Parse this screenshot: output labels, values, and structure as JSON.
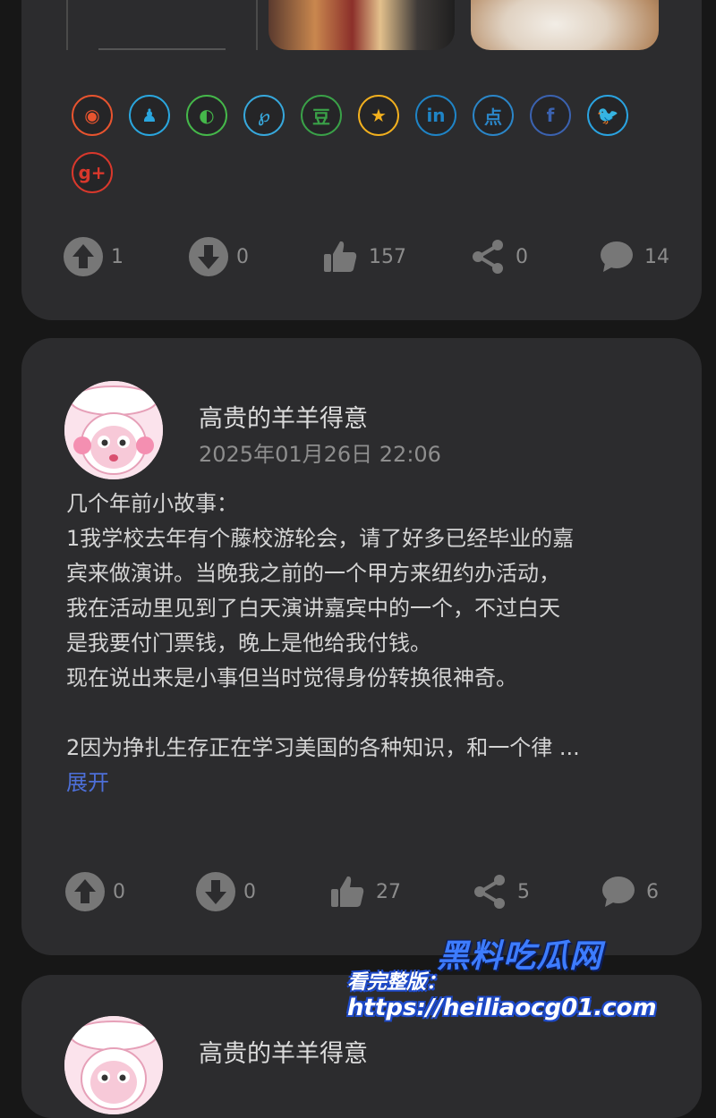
{
  "post1": {
    "share_icons": [
      {
        "name": "weibo-icon",
        "color": "#e8542f",
        "glyph": "◉"
      },
      {
        "name": "qq-icon",
        "color": "#2aa6de",
        "glyph": "♟"
      },
      {
        "name": "wechat-icon",
        "color": "#45b84a",
        "glyph": "◐"
      },
      {
        "name": "pinterest-icon",
        "color": "#37a8dc",
        "glyph": "℘"
      },
      {
        "name": "douban-icon",
        "color": "#3aa148",
        "glyph": "豆"
      },
      {
        "name": "qzone-icon",
        "color": "#f2b01e",
        "glyph": "★"
      },
      {
        "name": "linkedin-icon",
        "color": "#1f84c6",
        "glyph": "in"
      },
      {
        "name": "dianping-icon",
        "color": "#2b86c8",
        "glyph": "点"
      },
      {
        "name": "facebook-icon",
        "color": "#3b62b0",
        "glyph": "f"
      },
      {
        "name": "twitter-icon",
        "color": "#2aa3e0",
        "glyph": "🐦"
      },
      {
        "name": "googleplus-icon",
        "color": "#d9382c",
        "glyph": "g+"
      }
    ],
    "stats": {
      "upvotes": "1",
      "downvotes": "0",
      "likes": "157",
      "shares": "0",
      "comments": "14"
    }
  },
  "post2": {
    "author": "高贵的羊羊得意",
    "date": "2025年01月26日 22:06",
    "body": "几个年前小故事：\n1我学校去年有个藤校游轮会，请了好多已经毕业的嘉\n宾来做演讲。当晚我之前的一个甲方来纽约办活动，\n我在活动里见到了白天演讲嘉宾中的一个，不过白天\n是我要付门票钱，晚上是他给我付钱。\n现在说出来是小事但当时觉得身份转换很神奇。\n\n2因为挣扎生存正在学习美国的各种知识，和一个律 ...",
    "expand": "展开",
    "stats": {
      "upvotes": "0",
      "downvotes": "0",
      "likes": "27",
      "shares": "5",
      "comments": "6"
    }
  },
  "post3": {
    "author": "高贵的羊羊得意"
  },
  "watermark": {
    "title": "黑料吃瓜网",
    "label": "看完整版：",
    "url": "https://heiliaocg01.com"
  }
}
